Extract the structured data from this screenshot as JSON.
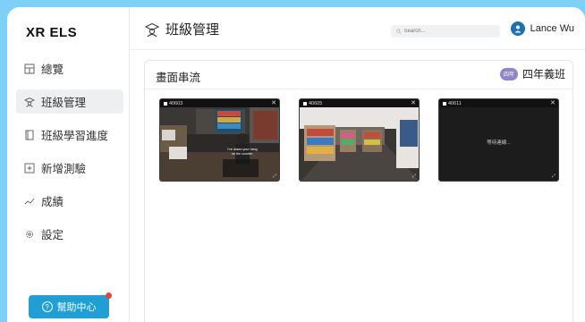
{
  "app": {
    "brand": "XR ELS"
  },
  "sidebar": {
    "items": [
      {
        "label": "總覽",
        "icon": "dashboard-icon",
        "active": false
      },
      {
        "label": "班級管理",
        "icon": "class-icon",
        "active": true
      },
      {
        "label": "班級學習進度",
        "icon": "progress-book-icon",
        "active": false
      },
      {
        "label": "新增測驗",
        "icon": "add-icon",
        "active": false
      },
      {
        "label": "成績",
        "icon": "chart-line-icon",
        "active": false
      },
      {
        "label": "設定",
        "icon": "gear-icon",
        "active": false
      }
    ],
    "help_label": "幫助中心"
  },
  "header": {
    "title": "班級管理",
    "search_placeholder": "Search...",
    "user_name": "Lance Wu"
  },
  "panel": {
    "title": "畫面串流",
    "class_badge": "四年",
    "class_name": "四年義班"
  },
  "streams": [
    {
      "id": "40603",
      "caption": "I've drawn your hang on the counter."
    },
    {
      "id": "40605",
      "caption": ""
    },
    {
      "id": "40611",
      "status": "等待連線..."
    }
  ],
  "colors": {
    "page_bg": "#7fd0f6",
    "accent": "#1f9fd6",
    "badge": "#8e86c7",
    "alert": "#e5453a"
  }
}
